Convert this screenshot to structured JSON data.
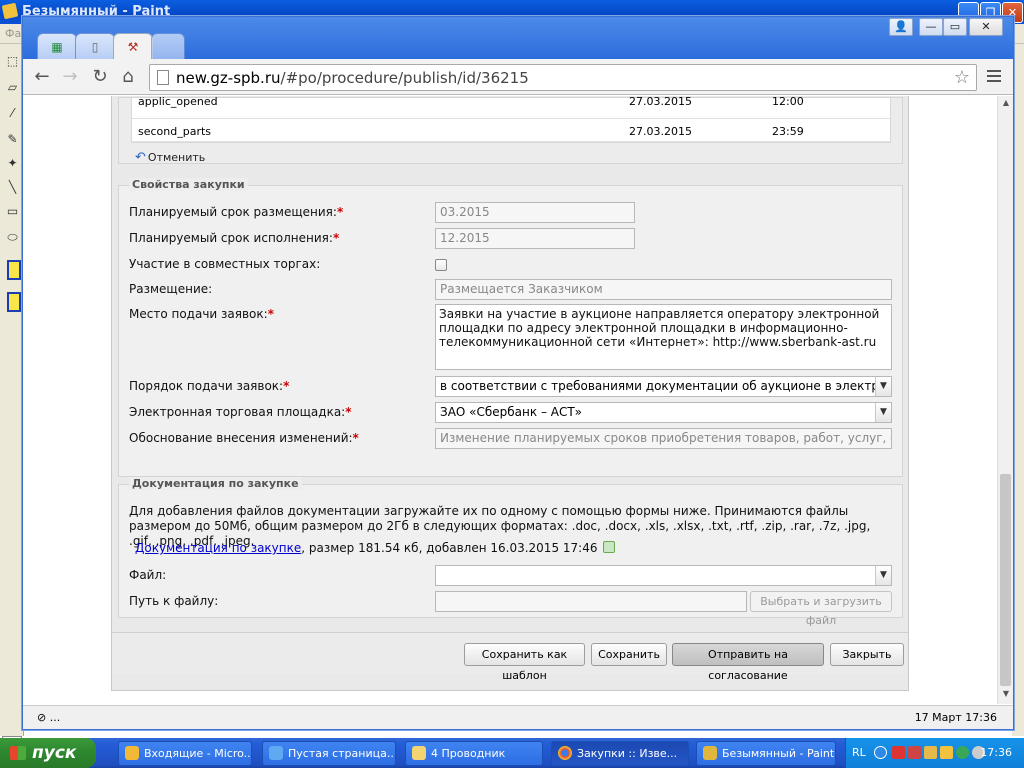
{
  "paint": {
    "title": "Безымянный - Paint",
    "menu_first": "Фа"
  },
  "browser": {
    "url_prefix": "new.gz-spb.ru",
    "url_rest": "/#po/procedure/publish/id/36215",
    "status_left": "⊘ ...",
    "status_right": "17 Март 17:36"
  },
  "dates_grid": {
    "rows": [
      {
        "name": "applic_opened",
        "date": "27.03.2015",
        "time": "12:00"
      },
      {
        "name": "second_parts",
        "date": "27.03.2015",
        "time": "23:59"
      }
    ],
    "undo_label": "Отменить"
  },
  "properties": {
    "legend": "Свойства закупки",
    "planned_placement_label": "Планируемый срок размещения:",
    "planned_placement_value": "03.2015",
    "planned_execution_label": "Планируемый срок исполнения:",
    "planned_execution_value": "12.2015",
    "joint_bidding_label": "Участие в совместных торгах:",
    "placement_label": "Размещение:",
    "placement_value": "Размещается Заказчиком",
    "submission_place_label": "Место подачи заявок:",
    "submission_place_value": "Заявки на участие в аукционе направляется оператору электронной площадки по адресу электронной площадки в информационно-телекоммуникационной сети «Интернет»: http://www.sberbank-ast.ru",
    "submission_order_label": "Порядок подачи заявок:",
    "submission_order_value": "в соответствии с требованиями документации об аукционе в электронной",
    "platform_label": "Электронная торговая площадка:",
    "platform_value": "ЗАО «Сбербанк – АСТ»",
    "change_reason_label": "Обоснование внесения изменений:",
    "change_reason_value": "Изменение планируемых сроков приобретения товаров, работ, услуг, способ",
    "required_mark": "*"
  },
  "documents": {
    "legend": "Документация по закупке",
    "info": "Для добавления файлов документации загружайте их по одному с помощью формы ниже. Принимаются файлы размером до 50Мб, общим размером до 2Гб в следующих форматах: .doc, .docx, .xls, .xlsx, .txt, .rtf, .zip, .rar, .7z, .jpg, .gif, .png, .pdf, .jpeg.",
    "file_link": "Документация по закупке",
    "file_meta": ", размер 181.54 кб, добавлен 16.03.2015 17:46",
    "file_label": "Файл:",
    "path_label": "Путь к файлу:",
    "upload_button": "Выбрать и загрузить файл"
  },
  "footer": {
    "save_template": "Сохранить как шаблон",
    "save": "Сохранить",
    "send_approval": "Отправить на согласование",
    "close": "Закрыть"
  },
  "taskbar": {
    "start": "пуск",
    "tasks": [
      "Входящие - Micro...",
      "Пустая страница...",
      "4 Проводник",
      "Закупки :: Изве...",
      "Безымянный - Paint"
    ],
    "lang": "RL",
    "clock": "17:36"
  },
  "colors": {
    "xp_blue": "#245dd7",
    "start_green": "#2f8a2f",
    "required_red": "#cc0000",
    "link_blue": "#0000cc"
  }
}
